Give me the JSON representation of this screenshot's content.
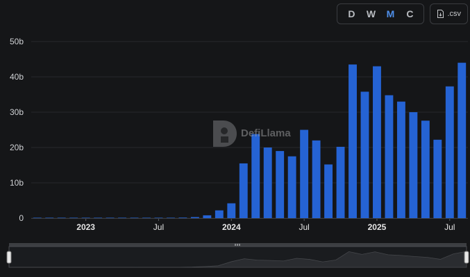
{
  "toolbar": {
    "periods": [
      {
        "label": "D",
        "active": false
      },
      {
        "label": "W",
        "active": false
      },
      {
        "label": "M",
        "active": true
      },
      {
        "label": "C",
        "active": false
      }
    ],
    "csv_label": ".csv",
    "csv_icon": "file-download-icon"
  },
  "watermark": {
    "text": "DefiLlama"
  },
  "colors": {
    "bar": "#2563d4",
    "grid": "#26282b",
    "background": "#151618",
    "active": "#4f8fea"
  },
  "chart_data": {
    "type": "bar",
    "title": "",
    "xlabel": "",
    "ylabel": "",
    "ylim": [
      0,
      50
    ],
    "y_unit": "b",
    "yticks": [
      "0",
      "10b",
      "20b",
      "30b",
      "40b",
      "50b"
    ],
    "x_start": "2022-09",
    "xticks": [
      {
        "label": "2023",
        "date": "2023-01",
        "bold": true
      },
      {
        "label": "Jul",
        "date": "2023-07",
        "bold": false
      },
      {
        "label": "2024",
        "date": "2024-01",
        "bold": true
      },
      {
        "label": "Jul",
        "date": "2024-07",
        "bold": false
      },
      {
        "label": "2025",
        "date": "2025-01",
        "bold": true
      },
      {
        "label": "Jul",
        "date": "2025-07",
        "bold": false
      }
    ],
    "categories": [
      "2022-09",
      "2022-10",
      "2022-11",
      "2022-12",
      "2023-01",
      "2023-02",
      "2023-03",
      "2023-04",
      "2023-05",
      "2023-06",
      "2023-07",
      "2023-08",
      "2023-09",
      "2023-10",
      "2023-11",
      "2023-12",
      "2024-01",
      "2024-02",
      "2024-03",
      "2024-04",
      "2024-05",
      "2024-06",
      "2024-07",
      "2024-08",
      "2024-09",
      "2024-10",
      "2024-11",
      "2024-12",
      "2025-01",
      "2025-02",
      "2025-03",
      "2025-04",
      "2025-05",
      "2025-06",
      "2025-07",
      "2025-08"
    ],
    "values": [
      0.02,
      0.02,
      0.03,
      0.03,
      0.04,
      0.04,
      0.05,
      0.05,
      0.06,
      0.07,
      0.08,
      0.1,
      0.15,
      0.3,
      0.8,
      2.2,
      4.2,
      15.5,
      23.8,
      20.0,
      19.0,
      17.5,
      25.0,
      22.0,
      15.2,
      20.2,
      43.5,
      35.8,
      43.0,
      34.8,
      33.0,
      30.0,
      27.6,
      22.2,
      37.3,
      44.0
    ]
  },
  "zoom_slider": {
    "handle_icon": "drag-grip-icon",
    "range": [
      0,
      1
    ]
  }
}
